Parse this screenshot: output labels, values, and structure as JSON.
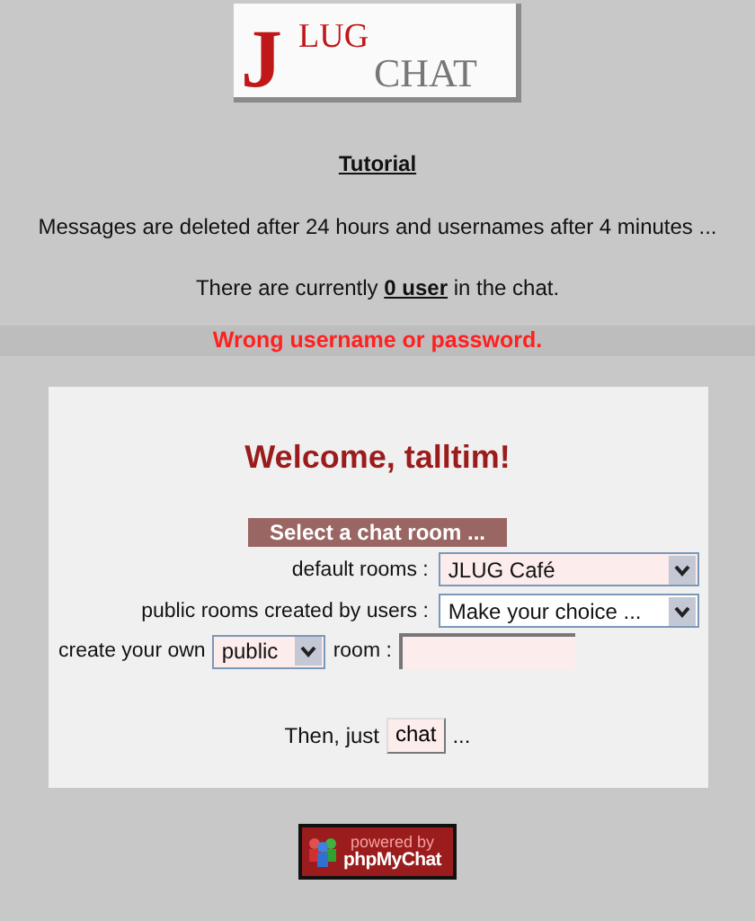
{
  "logo": {
    "initial": "J",
    "top": "LUG",
    "bottom": "CHAT"
  },
  "tutorial_link": "Tutorial",
  "notice": "Messages are deleted after 24 hours and usernames after 4 minutes ...",
  "users_line": {
    "before": "There are currently ",
    "link": "0 user",
    "after": " in the chat."
  },
  "error": "Wrong username or password.",
  "panel": {
    "welcome": "Welcome, talltim!",
    "section_title": "Select a chat room ...",
    "default_rooms": {
      "label": "default rooms :",
      "value": "JLUG Café"
    },
    "public_rooms": {
      "label": "public rooms created by users :",
      "value": "Make your choice ..."
    },
    "create": {
      "label": "create your own",
      "type_value": "public",
      "room_label": "room :"
    },
    "then": {
      "before": "Then, just",
      "button": "chat",
      "after": "..."
    }
  },
  "badge": {
    "top": "powered by",
    "bottom": "phpMyChat"
  }
}
